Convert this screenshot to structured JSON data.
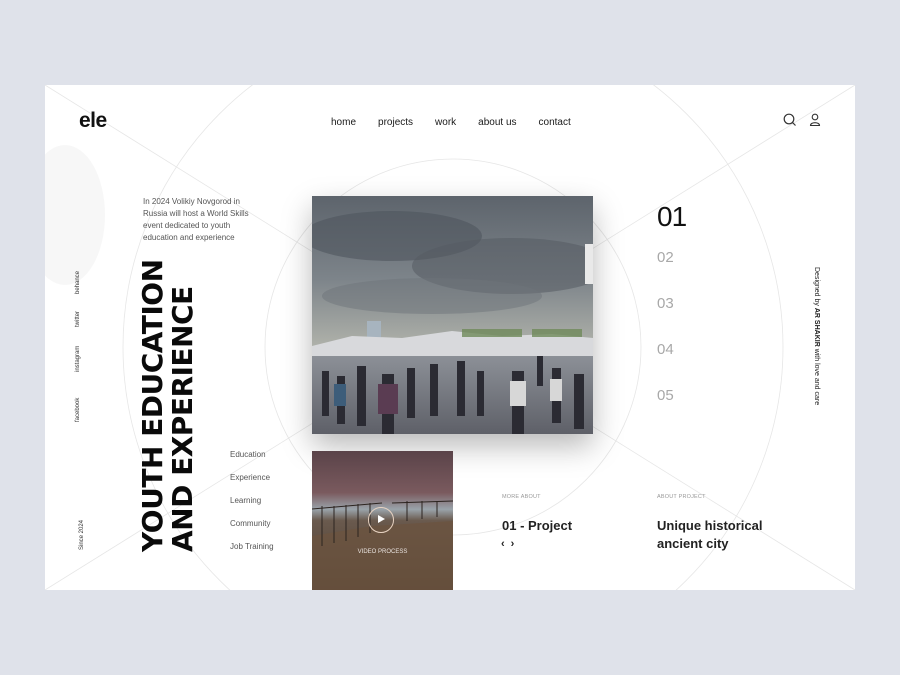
{
  "brand": {
    "logo": "ele"
  },
  "nav": {
    "items": [
      {
        "label": "home"
      },
      {
        "label": "projects"
      },
      {
        "label": "work"
      },
      {
        "label": "about us"
      },
      {
        "label": "contact"
      }
    ]
  },
  "header_icons": {
    "search": "search-icon",
    "user": "user-icon"
  },
  "intro": {
    "text": "In 2024 Volikiy Novgorod in Russia will host a World Skills event dedicated to youth education and experience"
  },
  "social": {
    "items": [
      {
        "label": "behance"
      },
      {
        "label": "twitter"
      },
      {
        "label": "instagram"
      },
      {
        "label": "facebook"
      }
    ]
  },
  "since": "Since 2024",
  "headline": {
    "line1": "YOUTH EDUCATION",
    "line2": "AND EXPERIENCE"
  },
  "topics": [
    {
      "label": "Education"
    },
    {
      "label": "Experience"
    },
    {
      "label": "Learning"
    },
    {
      "label": "Community"
    },
    {
      "label": "Job Training"
    }
  ],
  "video": {
    "label": "VIDEO PROCESS",
    "icon": "play-icon"
  },
  "slides": {
    "active": "01",
    "items": [
      {
        "label": "02"
      },
      {
        "label": "03"
      },
      {
        "label": "04"
      },
      {
        "label": "05"
      }
    ]
  },
  "credit": {
    "prefix": "Designed by ",
    "author": "AR SHAKIR",
    "suffix": " with love and care"
  },
  "more_about": {
    "kicker": "MORE ABOUT",
    "title": "01 - Project",
    "prev": "‹",
    "next": "›"
  },
  "about_project": {
    "kicker": "ABOUT PROJECT",
    "title": "Unique historical ancient city"
  },
  "colors": {
    "page_bg": "#dfe2ea",
    "card_bg": "#ffffff",
    "text": "#111111",
    "muted": "#a8a8a8"
  }
}
